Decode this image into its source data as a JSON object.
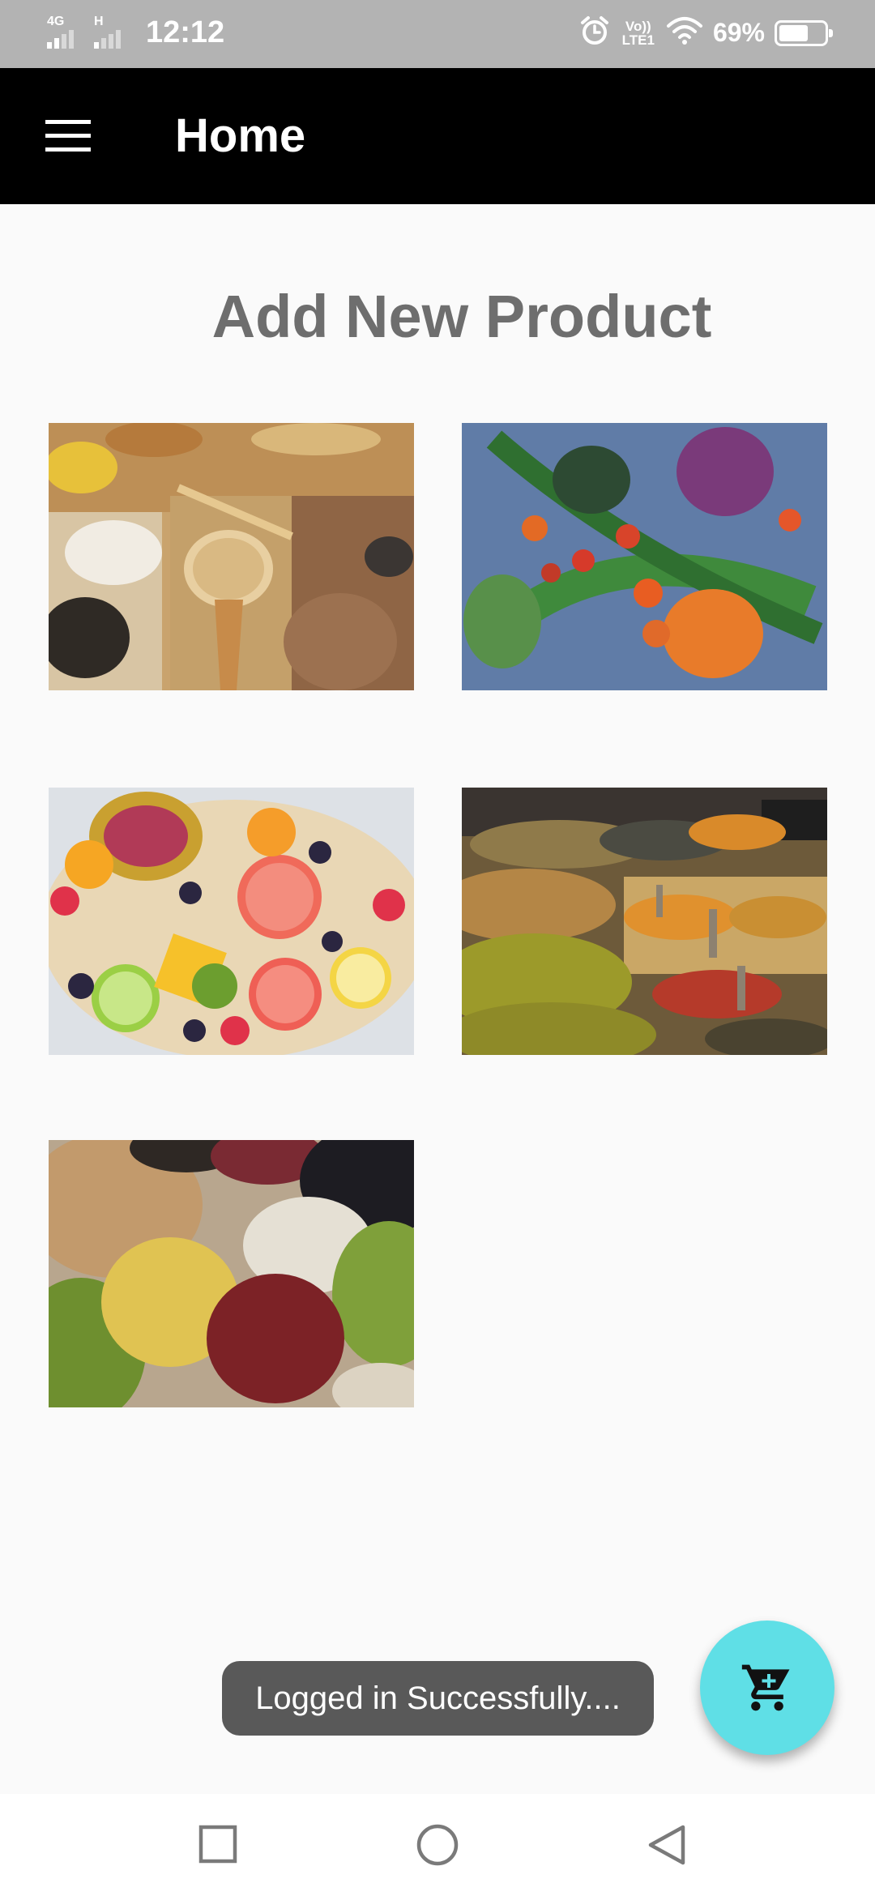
{
  "status_bar": {
    "network_1": "4G",
    "network_2": "H",
    "time": "12:12",
    "volte_top": "Vo))",
    "volte_bottom": "LTE1",
    "battery_percent": "69%",
    "battery_level": 0.69,
    "icons": [
      "signal-icon",
      "alarm-icon",
      "volte-icon",
      "wifi-icon",
      "battery-icon"
    ]
  },
  "app_bar": {
    "title": "Home",
    "menu_icon": "hamburger-menu-icon"
  },
  "main": {
    "heading": "Add New Product",
    "categories": [
      {
        "image": "grains-and-seeds-photo"
      },
      {
        "image": "vegetables-photo"
      },
      {
        "image": "fruit-platter-photo"
      },
      {
        "image": "spice-market-photo"
      },
      {
        "image": "beans-and-pulses-photo"
      }
    ]
  },
  "toast": {
    "message": "Logged in Successfully...."
  },
  "fab": {
    "icon": "shopping-cart-icon",
    "color": "#5fdfe6"
  },
  "nav_bar": {
    "icons": [
      "recent-apps-icon",
      "home-icon",
      "back-icon"
    ]
  },
  "colors": {
    "status_bar": "#b3b3b3",
    "app_bar": "#000000",
    "background": "#fafafa",
    "heading": "#6e6e6e",
    "toast": "#595959"
  }
}
